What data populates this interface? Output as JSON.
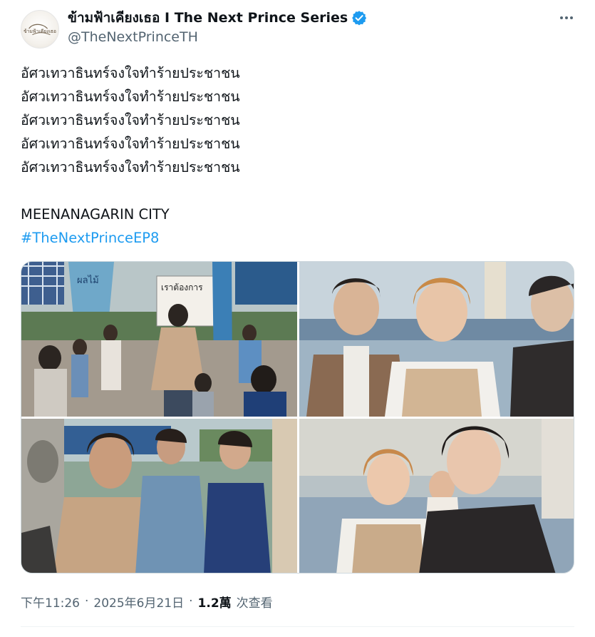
{
  "author": {
    "display_name": "ข้ามฟ้าเคียงเธอ I The Next Prince Series",
    "handle": "@TheNextPrinceTH",
    "verified": true,
    "avatar_icon": "series-logo-avatar",
    "avatar_logo_text": "ข้ามฟ้าเคียงเธอ"
  },
  "tweet": {
    "lines": [
      "อัศวเทวาธินทร์จงใจทำร้ายประชาชน",
      "อัศวเทวาธินทร์จงใจทำร้ายประชาชน",
      "อัศวเทวาธินทร์จงใจทำร้ายประชาชน",
      "อัศวเทวาธินทร์จงใจทำร้ายประชาชน",
      "อัศวเทวาธินทร์จงใจทำร้ายประชาชน"
    ],
    "city": "MEENANAGARIN CITY",
    "hashtag": "#TheNextPrinceEP8"
  },
  "media": {
    "image1": {
      "sign_text": "เราต้องการ",
      "banner_text": "ผลไม้"
    },
    "image2": {},
    "image3": {},
    "image4": {}
  },
  "meta": {
    "time": "下午11:26",
    "separator": "·",
    "date": "2025年6月21日",
    "views_count": "1.2萬",
    "views_label": "次查看"
  },
  "colors": {
    "text": "#0f1419",
    "secondary": "#536471",
    "accent": "#1d9bf0",
    "border": "#cfd9de"
  }
}
